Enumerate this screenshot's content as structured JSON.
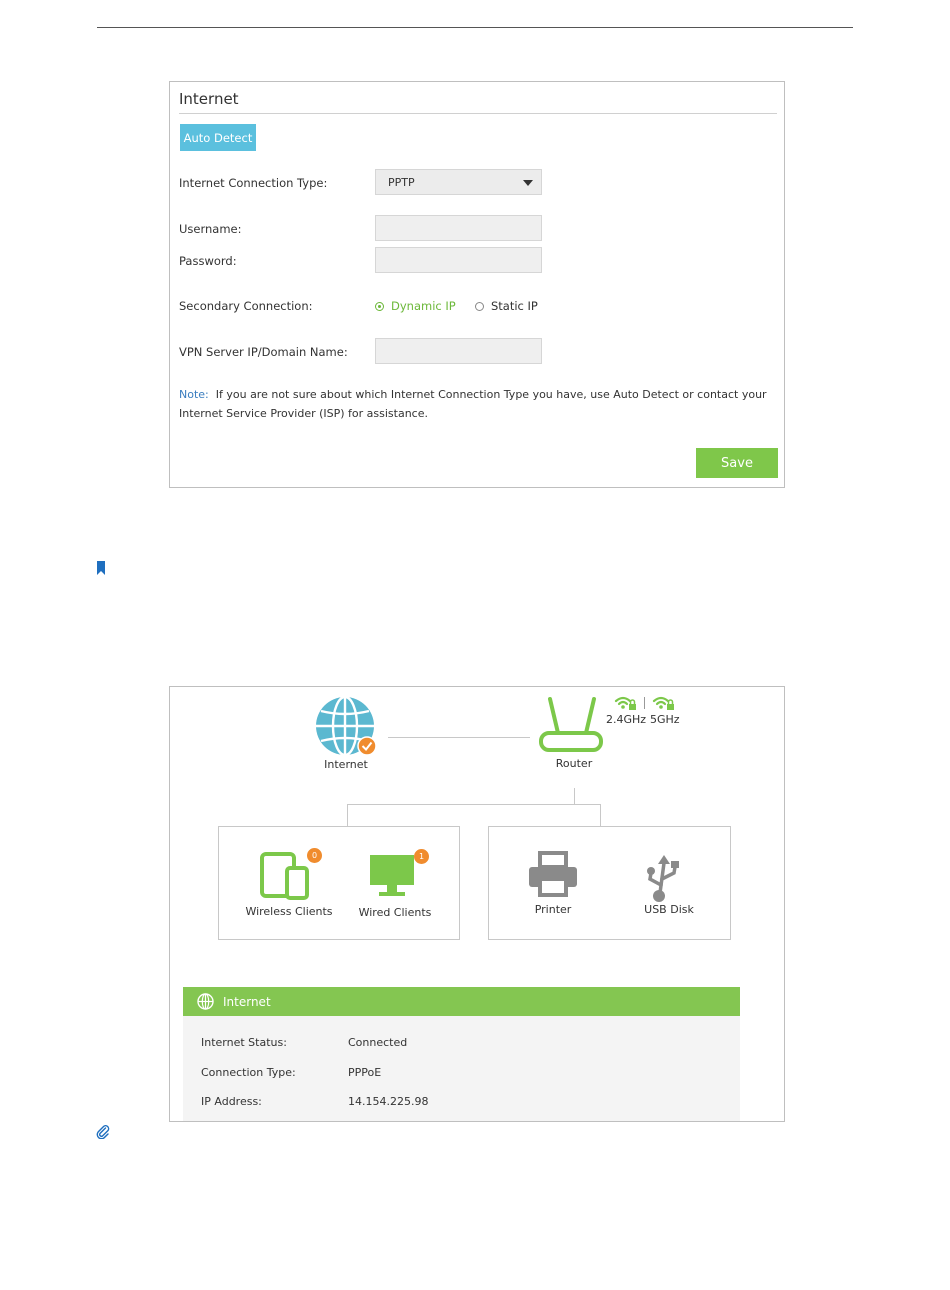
{
  "internet_form": {
    "title": "Internet",
    "auto_detect_label": "Auto Detect",
    "connection_type_label": "Internet Connection Type:",
    "connection_type_value": "PPTP",
    "username_label": "Username:",
    "username_value": "",
    "password_label": "Password:",
    "password_value": "",
    "secondary_label": "Secondary Connection:",
    "secondary_options": [
      "Dynamic IP",
      "Static IP"
    ],
    "secondary_selected": "Dynamic IP",
    "vpn_label": "VPN Server IP/Domain Name:",
    "vpn_value": "",
    "note_label": "Note:",
    "note_text": "If you are not sure about which Internet Connection Type you have, use Auto Detect or contact your Internet Service Provider (ISP) for assistance.",
    "save_label": "Save",
    "colors": {
      "auto_detect": "#5bc0de",
      "save": "#7fc74a",
      "radio_selected": "#6cb83a",
      "note_label": "#3a7dbf"
    }
  },
  "network_map": {
    "internet_label": "Internet",
    "router_label": "Router",
    "band_24": "2.4GHz",
    "band_5": "5GHz",
    "wireless_clients_label": "Wireless Clients",
    "wireless_clients_count": "0",
    "wired_clients_label": "Wired Clients",
    "wired_clients_count": "1",
    "printer_label": "Printer",
    "usb_label": "USB Disk",
    "status_title": "Internet",
    "status_rows": [
      {
        "label": "Internet Status:",
        "value": "Connected"
      },
      {
        "label": "Connection Type:",
        "value": "PPPoE"
      },
      {
        "label": "IP Address:",
        "value": "14.154.225.98"
      }
    ],
    "colors": {
      "globe": "#5bb8d0",
      "device_green": "#7cc84a",
      "badge": "#f08c2e",
      "status_header": "#84c651",
      "usb_printer": "#8a8a8a"
    }
  },
  "icons": [
    "bookmark-icon",
    "paperclip-icon",
    "globe-icon",
    "router-icon",
    "wifi-lock-icon",
    "tablet-phone-icon",
    "monitor-icon",
    "printer-icon",
    "usb-icon",
    "dropdown-caret-icon"
  ]
}
